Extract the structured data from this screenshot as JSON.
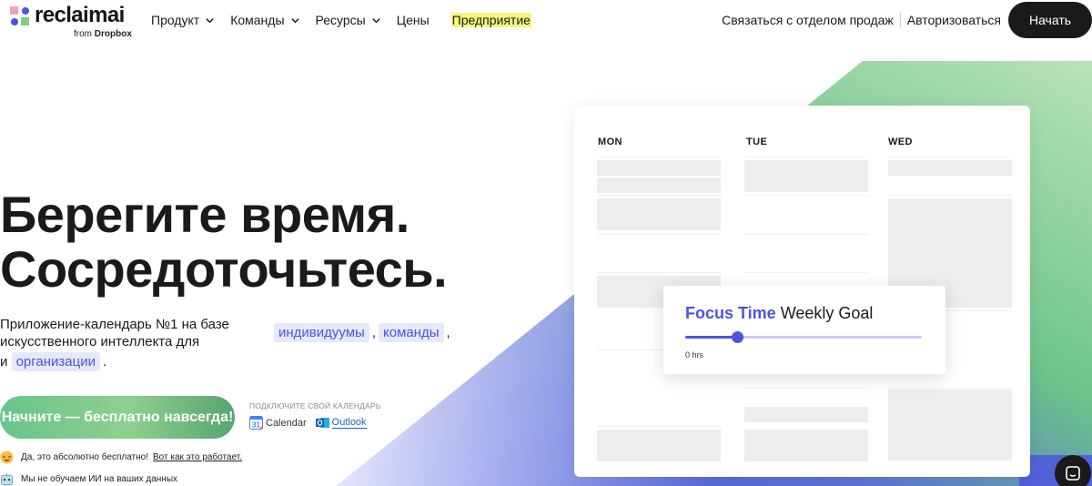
{
  "brand": {
    "name": "reclaimai",
    "sub_prefix": "from",
    "sub_brand": "Dropbox",
    "colors": {
      "accent": "#4a54e1",
      "dark": "#1a1a1a",
      "highlight": "#f6f67a"
    }
  },
  "nav": {
    "items": [
      {
        "label": "Продукт",
        "has_menu": true
      },
      {
        "label": "Команды",
        "has_menu": true
      },
      {
        "label": "Ресурсы",
        "has_menu": true
      },
      {
        "label": "Цены",
        "has_menu": false
      },
      {
        "label": "Предприятие",
        "has_menu": false
      }
    ],
    "contact_sales": "Связаться с отделом продаж",
    "login": "Авторизоваться",
    "start": "Начать"
  },
  "hero": {
    "title_line1": "Берегите время.",
    "title_line2": "Сосредоточьтесь.",
    "subtitle_line1": "Приложение-календарь №1 на базе",
    "subtitle_line2": "искусственного интеллекта для",
    "subtitle_line3_prefix": "и",
    "chips": [
      "индивидуумы",
      "команды",
      "организации"
    ],
    "comma": ",",
    "period": ".",
    "cta": "Начните — бесплатно навсегда!",
    "connect_label": "ПОДКЛЮЧИТЕ СВОЙ КАЛЕНДАРЬ",
    "apps": [
      {
        "name": "Calendar",
        "icon": "google-calendar-icon"
      },
      {
        "name": "Outlook",
        "icon": "outlook-icon"
      }
    ],
    "note_free": "Да, это абсолютно бесплатно!",
    "note_free_link": "Вот как это работает.",
    "note_ai": "Мы не обучаем ИИ на ваших данных"
  },
  "calendar": {
    "days": [
      "MON",
      "TUE",
      "WED"
    ]
  },
  "focus_goal": {
    "accent_text": "Focus Time",
    "rest_text": "Weekly Goal",
    "value_text": "0 hrs",
    "progress": 0.22
  }
}
